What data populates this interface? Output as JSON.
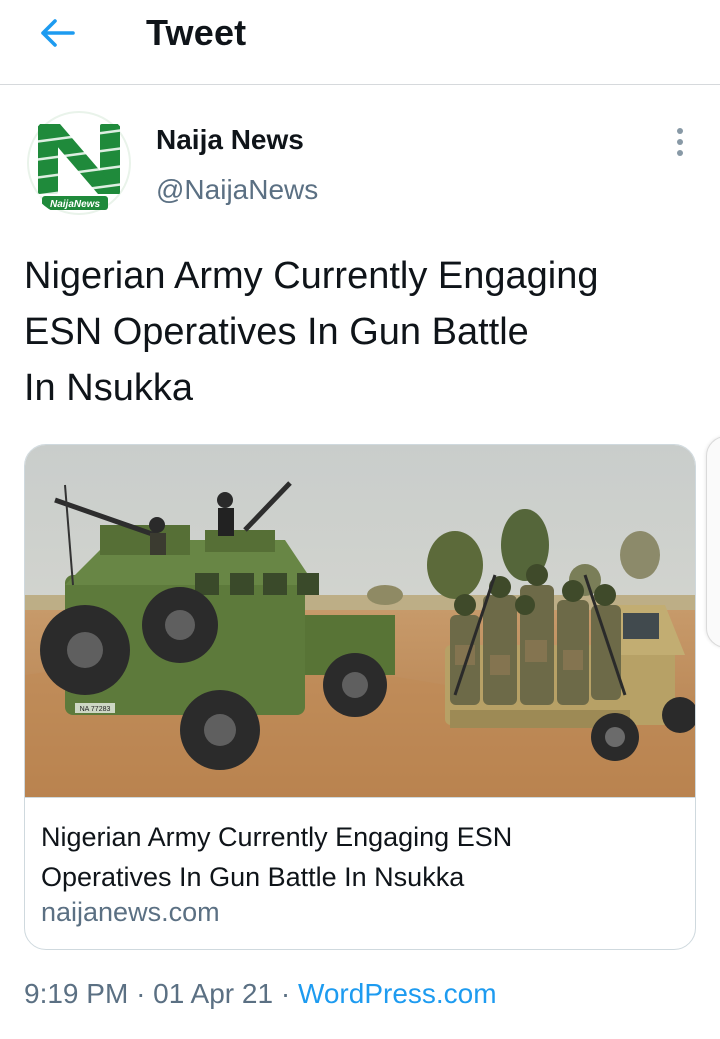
{
  "header": {
    "title": "Tweet",
    "back_icon": "arrow-left-icon"
  },
  "author": {
    "name": "Naija News",
    "handle": "@NaijaNews",
    "avatar_text": "NaijaNews"
  },
  "tweet": {
    "text_lines": [
      "Nigerian Army Currently Engaging",
      "ESN Operatives In Gun Battle",
      "In Nsukka"
    ]
  },
  "card": {
    "title_lines": [
      "Nigerian Army Currently Engaging ESN",
      "Operatives In Gun Battle In Nsukka"
    ],
    "domain": "naijanews.com",
    "vehicle_plate": "NA 77283"
  },
  "meta": {
    "time": "9:19 PM",
    "separator": "·",
    "date": "01 Apr 21",
    "source": "WordPress.com"
  },
  "colors": {
    "accent": "#1d9bf0",
    "secondary_text": "#5b7083",
    "primary_text": "#0f1419",
    "brand_green": "#1f8a3b"
  }
}
